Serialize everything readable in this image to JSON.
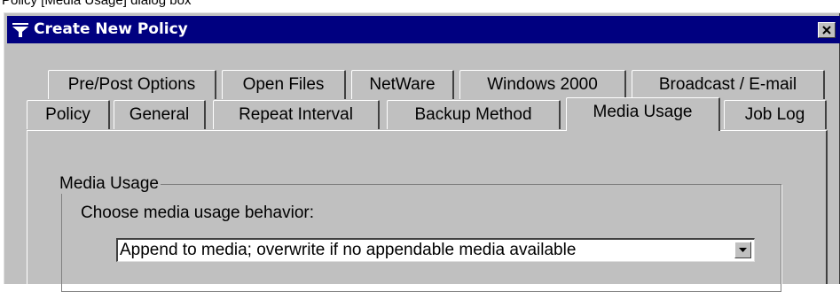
{
  "caption": "Policy [Media Usage] dialog box",
  "dialog": {
    "title": "Create New Policy",
    "close_icon": "close-x-icon",
    "title_icon": "funnel-icon"
  },
  "tabs_back_row": [
    {
      "id": "pre-post-options",
      "label": "Pre/Post Options"
    },
    {
      "id": "open-files",
      "label": "Open Files"
    },
    {
      "id": "netware",
      "label": "NetWare"
    },
    {
      "id": "windows-2000",
      "label": "Windows 2000"
    },
    {
      "id": "broadcast-email",
      "label": "Broadcast / E-mail"
    }
  ],
  "tabs_front_row": [
    {
      "id": "policy",
      "label": "Policy"
    },
    {
      "id": "general",
      "label": "General"
    },
    {
      "id": "repeat-interval",
      "label": "Repeat Interval"
    },
    {
      "id": "backup-method",
      "label": "Backup Method"
    },
    {
      "id": "media-usage",
      "label": "Media Usage",
      "active": true
    },
    {
      "id": "job-log",
      "label": "Job Log"
    }
  ],
  "media_usage": {
    "group_label": "Media Usage",
    "prompt": "Choose media usage behavior:",
    "selected_option": "Append to media; overwrite if no appendable media available",
    "dropdown_icon": "dropdown-arrow-icon"
  },
  "colors": {
    "titlebar": "#000080",
    "face": "#c0c0c0",
    "highlight": "#ffffff",
    "shadow": "#404040"
  }
}
